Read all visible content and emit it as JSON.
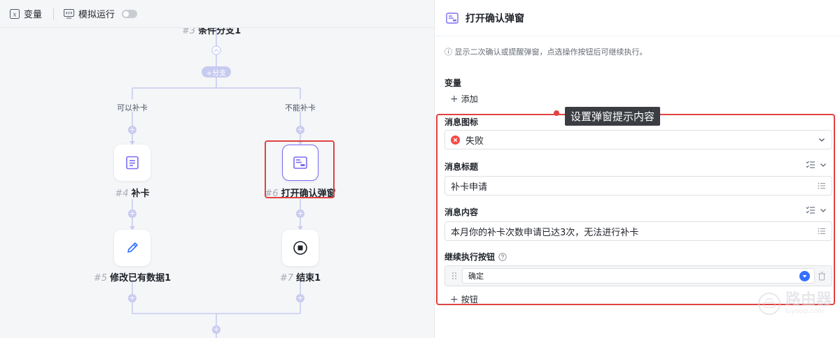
{
  "toolbar": {
    "variables_label": "变量",
    "simulate_label": "模拟运行"
  },
  "flow": {
    "condition": {
      "num": "#3",
      "title": "条件分支1"
    },
    "add_branch_label": "+分支",
    "branches": [
      {
        "label": "可以补卡"
      },
      {
        "label": "不能补卡"
      }
    ],
    "nodes": [
      {
        "num": "#4",
        "title": "补卡"
      },
      {
        "num": "#6",
        "title": "打开确认弹窗"
      },
      {
        "num": "#5",
        "title": "修改已有数据1"
      },
      {
        "num": "#7",
        "title": "结束1"
      }
    ],
    "plus_symbol": "+"
  },
  "panel": {
    "title": "打开确认弹窗",
    "description": "ⓘ 显示二次确认或提醒弹窗，点选操作按钮后可继续执行。",
    "variables": {
      "title": "变量",
      "add_label": "添加"
    },
    "callout": "设置弹窗提示内容",
    "message_icon": {
      "title": "消息图标",
      "value": "失败"
    },
    "message_title": {
      "title": "消息标题",
      "value": "补卡申请"
    },
    "message_content": {
      "title": "消息内容",
      "value": "本月你的补卡次数申请已达3次，无法进行补卡"
    },
    "continue_button": {
      "title": "继续执行按钮",
      "item": "确定",
      "add_label": "按钮"
    }
  },
  "watermark": {
    "main": "路由器",
    "sub": "luyouqi.com"
  },
  "colors": {
    "accent": "#7b6cf6",
    "highlight": "#e04343",
    "flow_line": "#c8cbf0",
    "error": "#f54a45",
    "link_blue": "#3370ff"
  }
}
